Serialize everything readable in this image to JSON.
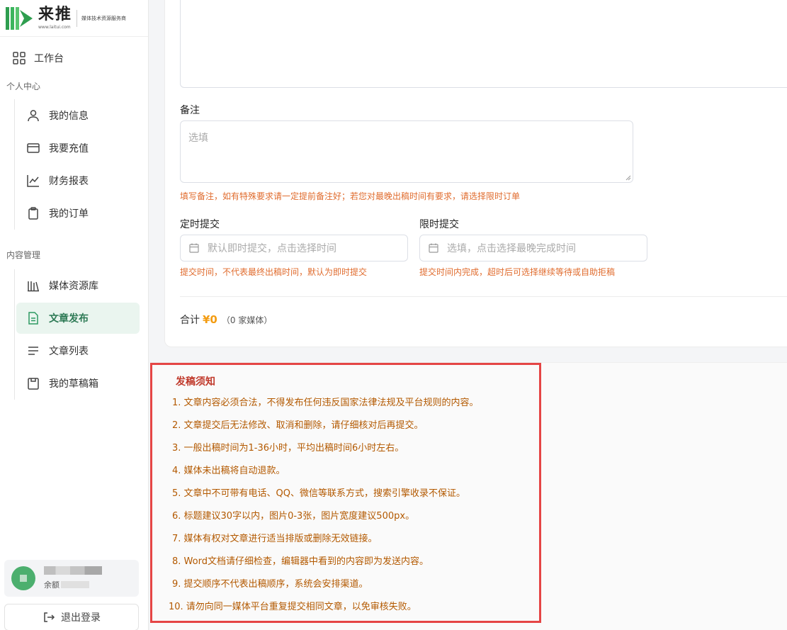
{
  "brand": {
    "name": "来推",
    "url": "www.laitui.com",
    "slogan": "媒体技术资源服务商"
  },
  "nav": {
    "workbench": "工作台",
    "sections": [
      {
        "label": "个人中心",
        "items": [
          "我的信息",
          "我要充值",
          "财务报表",
          "我的订单"
        ]
      },
      {
        "label": "内容管理",
        "items": [
          "媒体资源库",
          "文章发布",
          "文章列表",
          "我的草稿箱"
        ]
      }
    ],
    "active": "文章发布"
  },
  "user": {
    "balance_prefix": "余额"
  },
  "logout_label": "退出登录",
  "form": {
    "remark_label": "备注",
    "remark_placeholder": "选填",
    "remark_hint": "填写备注，如有特殊要求请一定提前备注好；若您对最晚出稿时间有要求，请选择限时订单",
    "scheduled_label": "定时提交",
    "scheduled_placeholder": "默认即时提交，点击选择时间",
    "scheduled_hint": "提交时间，不代表最终出稿时间，默认为即时提交",
    "limit_label": "限时提交",
    "limit_placeholder": "选填，点击选择最晚完成时间",
    "limit_hint": "提交时间内完成，超时后可选择继续等待或自助拒稿",
    "total_label": "合计",
    "total_amount": "¥0",
    "total_count": "（0 家媒体）"
  },
  "notice": {
    "title": "发稿须知",
    "items": [
      "1. 文章内容必须合法，不得发布任何违反国家法律法规及平台规则的内容。",
      "2. 文章提交后无法修改、取消和删除，请仔细核对后再提交。",
      "3. 一般出稿时间为1-36小时，平均出稿时间6小时左右。",
      "4. 媒体未出稿将自动退款。",
      "5. 文章中不可带有电话、QQ、微信等联系方式，搜索引擎收录不保证。",
      "6. 标题建议30字以内，图片0-3张，图片宽度建议500px。",
      "7. 媒体有权对文章进行适当排版或删除无效链接。",
      "8. Word文档请仔细检查，编辑器中看到的内容即为发送内容。",
      "9. 提交顺序不代表出稿顺序，系统会安排渠道。",
      "10. 请勿向同一媒体平台重复提交相同文章，以免审核失败。"
    ]
  },
  "colors": {
    "accent_green": "#2d9a62",
    "hint_orange": "#e06c2e",
    "notice_border": "#e54545",
    "amount": "#f39c12"
  }
}
